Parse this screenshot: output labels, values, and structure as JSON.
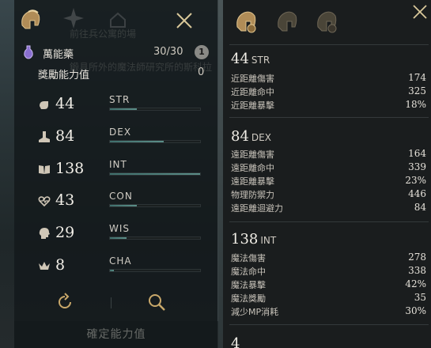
{
  "colors": {
    "accent_gold": "#c9a86a",
    "bar_fill": "#4f8580",
    "panel_bg": "#1a1d1e"
  },
  "left_panel": {
    "potion": {
      "name": "萬能藥",
      "count": "30/30",
      "info_label": "1",
      "icon": "potion-icon"
    },
    "bonus": {
      "label": "獎勵能力值",
      "value": "0"
    },
    "stats": [
      {
        "key": "str",
        "value": "44",
        "name": "STR",
        "fill": 0.3,
        "icon": "str-fist-icon"
      },
      {
        "key": "dex",
        "value": "84",
        "name": "DEX",
        "fill": 0.6,
        "icon": "dex-boot-icon"
      },
      {
        "key": "int",
        "value": "138",
        "name": "INT",
        "fill": 1.0,
        "icon": "int-book-icon"
      },
      {
        "key": "con",
        "value": "43",
        "name": "CON",
        "fill": 0.3,
        "icon": "con-heart-icon"
      },
      {
        "key": "wis",
        "value": "29",
        "name": "WIS",
        "fill": 0.18,
        "icon": "wis-head-icon"
      },
      {
        "key": "cha",
        "value": "8",
        "name": "CHA",
        "fill": 0.04,
        "icon": "cha-crown-icon"
      }
    ],
    "confirm_label": "確定能力值",
    "faded": {
      "bg_text_1": "鍛具所外的魔法師研究所的斯科拉",
      "bg_text_2": "前往兵公寓的場"
    }
  },
  "right_panel": {
    "groups": [
      {
        "num": "44",
        "abbr": "STR",
        "lines": [
          {
            "label": "近距離傷害",
            "value": "174"
          },
          {
            "label": "近距離命中",
            "value": "325"
          },
          {
            "label": "近距離暴擊",
            "value": "18%"
          }
        ]
      },
      {
        "num": "84",
        "abbr": "DEX",
        "lines": [
          {
            "label": "遠距離傷害",
            "value": "164"
          },
          {
            "label": "遠距離命中",
            "value": "339"
          },
          {
            "label": "遠距離暴擊",
            "value": "23%"
          },
          {
            "label": "物理防禦力",
            "value": "446"
          },
          {
            "label": "遠距離迴避力",
            "value": "84"
          }
        ]
      },
      {
        "num": "138",
        "abbr": "INT",
        "lines": [
          {
            "label": "魔法傷害",
            "value": "278"
          },
          {
            "label": "魔法命中",
            "value": "338"
          },
          {
            "label": "魔法暴擊",
            "value": "42%"
          },
          {
            "label": "魔法獎勵",
            "value": "35"
          },
          {
            "label": "減少MP消耗",
            "value": "30%"
          }
        ]
      }
    ],
    "partial_next": "4"
  }
}
